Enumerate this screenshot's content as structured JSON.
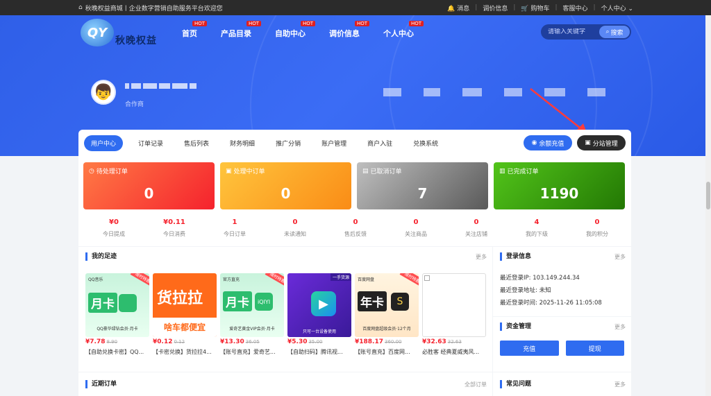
{
  "topbar": {
    "welcome": "秋晚权益商城丨企业数字营销自助服务平台欢迎您",
    "links": [
      "消息",
      "调价信息",
      "购物车",
      "客服中心",
      "个人中心"
    ]
  },
  "logo": {
    "text": "秋晚权益",
    "mark": "QY"
  },
  "nav": [
    {
      "label": "首页",
      "badge": "HOT"
    },
    {
      "label": "产品目录",
      "badge": "HOT"
    },
    {
      "label": "自助中心",
      "badge": "HOT"
    },
    {
      "label": "调价信息",
      "badge": "HOT"
    },
    {
      "label": "个人中心",
      "badge": "HOT"
    }
  ],
  "search": {
    "placeholder": "请输入关键字",
    "button": "搜索"
  },
  "profile": {
    "role": "合作商"
  },
  "tabs": [
    "用户中心",
    "订单记录",
    "售后列表",
    "财务明细",
    "推广分销",
    "账户管理",
    "商户入驻",
    "兑换系统"
  ],
  "actions": {
    "charge": "余额充值",
    "sub": "分站管理"
  },
  "order_cards": [
    {
      "title": "待处理订单",
      "count": "0"
    },
    {
      "title": "处理中订单",
      "count": "0"
    },
    {
      "title": "已取消订单",
      "count": "7"
    },
    {
      "title": "已完成订单",
      "count": "1190"
    }
  ],
  "mini_stats": [
    {
      "value": "¥0",
      "label": "今日提成"
    },
    {
      "value": "¥0.11",
      "label": "今日消费"
    },
    {
      "value": "1",
      "label": "今日订单"
    },
    {
      "value": "0",
      "label": "未读通知"
    },
    {
      "value": "0",
      "label": "售后反馈"
    },
    {
      "value": "0",
      "label": "关注商品"
    },
    {
      "value": "0",
      "label": "关注店铺"
    },
    {
      "value": "4",
      "label": "我的下级"
    },
    {
      "value": "0",
      "label": "我的积分"
    }
  ],
  "footprints": {
    "title": "我的足迹",
    "more": "更多",
    "items": [
      {
        "price": "¥7.78",
        "old": "8.90",
        "name": "【自助兑换卡密】QQ...",
        "art": "月卡",
        "top": "QQ音乐",
        "caption": "QQ豪华绿钻会员·月卡",
        "ribbon": "限时特惠"
      },
      {
        "price": "¥0.12",
        "old": "0.12",
        "name": "【卡密兑换】货拉拉4...",
        "art": "货拉拉",
        "top": "",
        "caption": "啥车都便宜",
        "ribbon": ""
      },
      {
        "price": "¥13.30",
        "old": "36.05",
        "name": "【账号直充】爱奇艺...",
        "art": "月卡",
        "top": "官方直充",
        "caption": "爱奇艺黄金VIP会员·月卡",
        "ribbon": "限时特惠"
      },
      {
        "price": "¥5.30",
        "old": "35.00",
        "name": "【自助扫码】腾讯视...",
        "art": "▶",
        "top": "一手货源",
        "caption": "只可一台设备使用",
        "ribbon": ""
      },
      {
        "price": "¥188.17",
        "old": "360.00",
        "name": "【账号直充】百度网...",
        "art": "年卡",
        "top": "百度网盘",
        "caption": "百度网盘超级会员·12个月",
        "ribbon": "限时特惠"
      },
      {
        "price": "¥32.63",
        "old": "32.63",
        "name": "必胜客 经典夏威夷风...",
        "art": "",
        "top": "",
        "caption": "",
        "ribbon": ""
      }
    ]
  },
  "login_info": {
    "title": "登录信息",
    "more": "更多",
    "ip": "最近登录IP: 103.149.244.34",
    "addr": "最近登录地址: 未知",
    "time": "最近登录时间: 2025-11-26 11:05:08"
  },
  "funds": {
    "title": "资金管理",
    "more": "更多",
    "recharge": "充值",
    "withdraw": "提现"
  },
  "recent_orders": {
    "title": "近期订单",
    "more": "全部订单"
  },
  "faq": {
    "title": "常见问题",
    "more": "更多"
  }
}
